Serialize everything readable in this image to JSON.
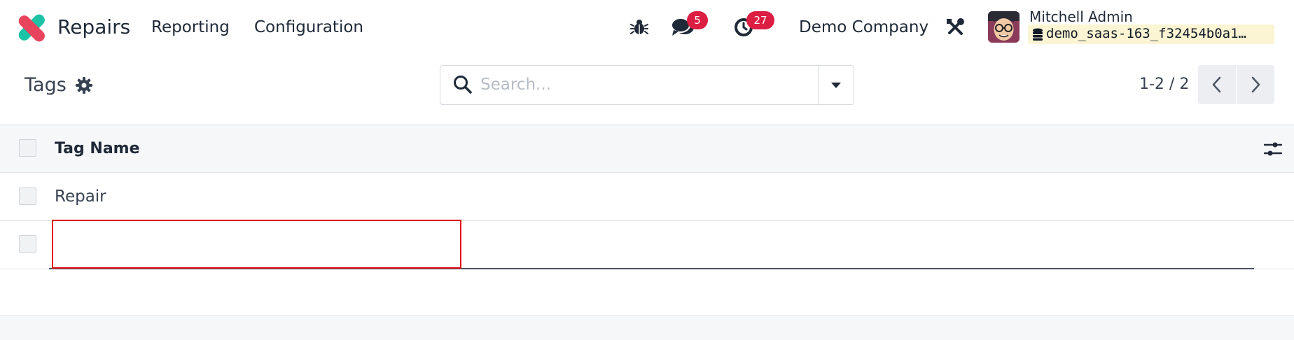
{
  "navbar": {
    "app_name": "Repairs",
    "menus": [
      {
        "label": "Reporting"
      },
      {
        "label": "Configuration"
      }
    ],
    "messages_count": "5",
    "activities_count": "27",
    "company": "Demo Company",
    "user_name": "Mitchell Admin",
    "database": "demo_saas-163_f32454b0a1…"
  },
  "control_panel": {
    "title": "Tags",
    "search_placeholder": "Search...",
    "pager": "1-2 / 2"
  },
  "table": {
    "columns": [
      "Tag Name"
    ],
    "rows": [
      {
        "tag_name": "Repair"
      },
      {
        "tag_name": ""
      }
    ]
  },
  "colors": {
    "badge": "#dc1e42",
    "edit_highlight": "#e0131c",
    "logo_pink": "#e8445d",
    "logo_teal": "#1dc3a6"
  },
  "icons": [
    "app-logo-icon",
    "bug-icon",
    "chat-icon",
    "clock-icon",
    "tools-icon",
    "avatar",
    "database-icon",
    "gear-icon",
    "search-icon",
    "caret-down-icon",
    "chevron-left-icon",
    "chevron-right-icon",
    "optional-columns-icon"
  ]
}
